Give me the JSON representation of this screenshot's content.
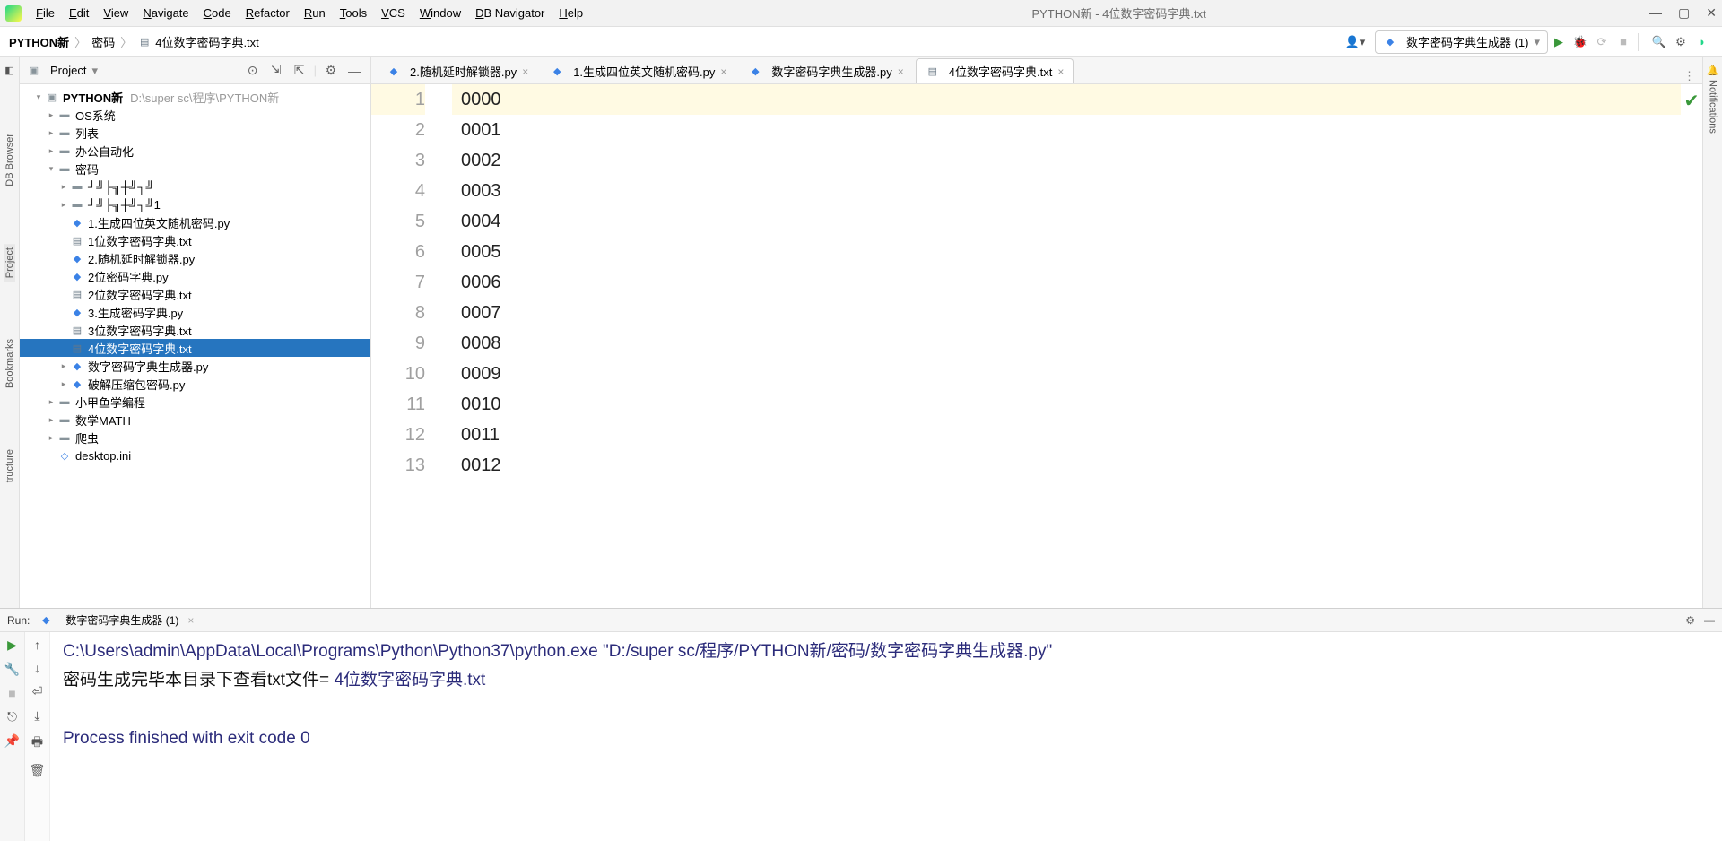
{
  "title": "PYTHON新 - 4位数字密码字典.txt",
  "menu": [
    "File",
    "Edit",
    "View",
    "Navigate",
    "Code",
    "Refactor",
    "Run",
    "Tools",
    "VCS",
    "Window",
    "DB Navigator",
    "Help"
  ],
  "breadcrumb": {
    "root": "PYTHON新",
    "mid": "密码",
    "file": "4位数字密码字典.txt"
  },
  "runConfig": "数字密码字典生成器 (1)",
  "panel": {
    "title": "Project"
  },
  "tree": {
    "rootName": "PYTHON新",
    "rootPath": "D:\\super sc\\程序\\PYTHON新",
    "folders_top": [
      "OS系统",
      "列表",
      "办公自动化"
    ],
    "pwd_folder": "密码",
    "pwd_sub1": "┘╝├╗┼╝┐╝",
    "pwd_sub2": "┘╝├╗┼╝┐╝1",
    "files": [
      {
        "n": "1.生成四位英文随机密码.py",
        "t": "py"
      },
      {
        "n": "1位数字密码字典.txt",
        "t": "txt"
      },
      {
        "n": "2.随机延时解锁器.py",
        "t": "py"
      },
      {
        "n": "2位密码字典.py",
        "t": "py"
      },
      {
        "n": "2位数字密码字典.txt",
        "t": "txt"
      },
      {
        "n": "3.生成密码字典.py",
        "t": "py"
      },
      {
        "n": "3位数字密码字典.txt",
        "t": "txt"
      },
      {
        "n": "4位数字密码字典.txt",
        "t": "txt",
        "sel": true
      },
      {
        "n": "数字密码字典生成器.py",
        "t": "py",
        "exp": true
      },
      {
        "n": "破解压缩包密码.py",
        "t": "py",
        "exp": true
      }
    ],
    "folders_bottom": [
      "小甲鱼学编程",
      "数学MATH",
      "爬虫"
    ],
    "extra_file": "desktop.ini"
  },
  "tabs": [
    {
      "label": "2.随机延时解锁器.py",
      "icon": "py"
    },
    {
      "label": "1.生成四位英文随机密码.py",
      "icon": "py"
    },
    {
      "label": "数字密码字典生成器.py",
      "icon": "py"
    },
    {
      "label": "4位数字密码字典.txt",
      "icon": "txt",
      "active": true
    }
  ],
  "editor_lines": [
    "0000",
    "0001",
    "0002",
    "0003",
    "0004",
    "0005",
    "0006",
    "0007",
    "0008",
    "0009",
    "0010",
    "0011",
    "0012"
  ],
  "run": {
    "label": "Run:",
    "tab": "数字密码字典生成器 (1)",
    "line1": "C:\\Users\\admin\\AppData\\Local\\Programs\\Python\\Python37\\python.exe \"D:/super sc/程序/PYTHON新/密码/数字密码字典生成器.py\"",
    "line2a": "密码生成完毕本目录下查看txt文件= ",
    "line2b": "4位数字密码字典.txt",
    "line3": "Process finished with exit code 0"
  },
  "side": {
    "dbbrowser": "DB Browser",
    "project": "Project",
    "bookmarks": "Bookmarks",
    "structure": "tructure",
    "notifications": "Notifications"
  }
}
